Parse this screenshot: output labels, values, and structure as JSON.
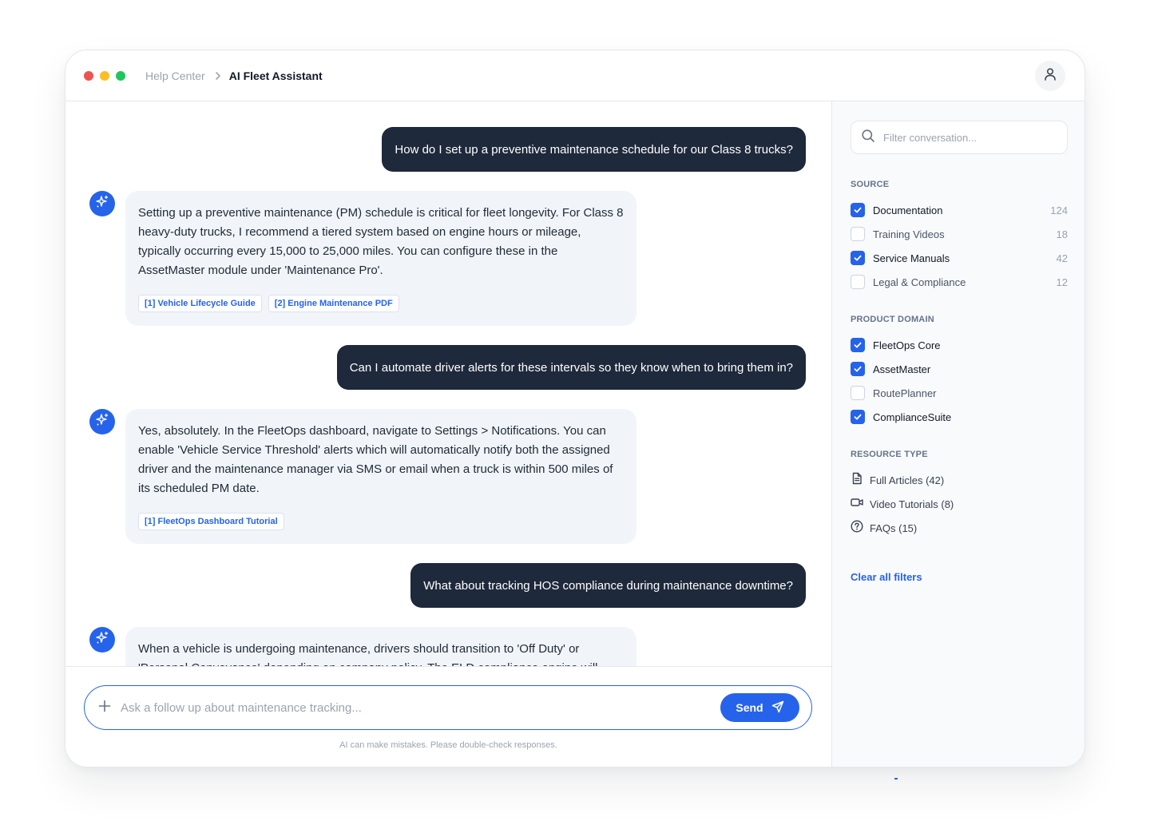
{
  "window": {
    "breadcrumb": {
      "parent": "Help Center",
      "current": "AI Fleet Assistant"
    }
  },
  "conversation": {
    "messages": [
      {
        "role": "user",
        "text": "How do I set up a preventive maintenance schedule for our Class 8 trucks?"
      },
      {
        "role": "assistant",
        "text": "Setting up a preventive maintenance (PM) schedule is critical for fleet longevity. For Class 8 heavy-duty trucks, I recommend a tiered system based on engine hours or mileage, typically occurring every 15,000 to 25,000 miles. You can configure these in the AssetMaster module under 'Maintenance Pro'.",
        "citations": [
          "[1] Vehicle Lifecycle Guide",
          "[2] Engine Maintenance PDF"
        ]
      },
      {
        "role": "user",
        "text": "Can I automate driver alerts for these intervals so they know when to bring them in?"
      },
      {
        "role": "assistant",
        "text": "Yes, absolutely. In the FleetOps dashboard, navigate to Settings > Notifications. You can enable 'Vehicle Service Threshold' alerts which will automatically notify both the assigned driver and the maintenance manager via SMS or email when a truck is within 500 miles of its scheduled PM date.",
        "citations": [
          "[1] FleetOps Dashboard Tutorial"
        ]
      },
      {
        "role": "user",
        "text": "What about tracking HOS compliance during maintenance downtime?"
      },
      {
        "role": "assistant",
        "text": "When a vehicle is undergoing maintenance, drivers should transition to 'Off Duty' or 'Personal Conveyance' depending on company policy. The ELD compliance engine will",
        "citations": []
      }
    ]
  },
  "composer": {
    "placeholder": "Ask a follow up about maintenance tracking...",
    "send_label": "Send",
    "disclaimer": "AI can make mistakes. Please double-check responses."
  },
  "sidebar": {
    "filter_placeholder": "Filter conversation...",
    "source": {
      "title": "SOURCE",
      "items": [
        {
          "label": "Documentation",
          "count": "124",
          "checked": true
        },
        {
          "label": "Training Videos",
          "count": "18",
          "checked": false
        },
        {
          "label": "Service Manuals",
          "count": "42",
          "checked": true
        },
        {
          "label": "Legal & Compliance",
          "count": "12",
          "checked": false
        }
      ]
    },
    "product_domain": {
      "title": "PRODUCT DOMAIN",
      "items": [
        {
          "label": "FleetOps Core",
          "checked": true
        },
        {
          "label": "AssetMaster",
          "checked": true
        },
        {
          "label": "RoutePlanner",
          "checked": false
        },
        {
          "label": "ComplianceSuite",
          "checked": true
        }
      ]
    },
    "resource_type": {
      "title": "RESOURCE TYPE",
      "items": [
        {
          "label": "Full Articles (42)",
          "icon": "document-icon"
        },
        {
          "label": "Video Tutorials (8)",
          "icon": "video-icon"
        },
        {
          "label": "FAQs (15)",
          "icon": "question-circle-icon"
        }
      ]
    },
    "clear_label": "Clear all filters"
  },
  "colors": {
    "accent": "#2563eb",
    "user_bubble": "#1e293b",
    "assistant_bubble": "#f1f5f9",
    "traffic_red": "#ef5350",
    "traffic_yellow": "#fbbf24",
    "traffic_green": "#22c55e"
  }
}
